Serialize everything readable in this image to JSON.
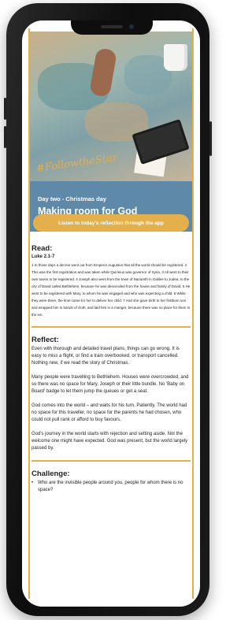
{
  "hero": {
    "logo_text": "#FollowtheStar"
  },
  "banner": {
    "subtitle": "Day two - Christmas day",
    "title": "Making room for God"
  },
  "listen_button": {
    "label": "Listen to today's reflection through the app"
  },
  "read": {
    "heading": "Read:",
    "reference": "Luke 2.1-7",
    "text": "1 In those days a decree went out from Emperor Augustus that all the world should be registered. 2 This was the first registration and was taken while Quirinius was governor of Syria. 3 All went to their own towns to be registered. 4 Joseph also went from the town of Nazareth in Galilee to Judea, to the city of David called Bethlehem, because he was descended from the house and family of David. 5 He went to be registered with Mary, to whom he was engaged and who was expecting a child. 6 While they were there, the time came for her to deliver her child. 7 And she gave birth to her firstborn son and wrapped him in bands of cloth, and laid him in a manger, because there was no place for them in the inn."
  },
  "reflect": {
    "heading": "Reflect:",
    "paragraphs": [
      "Even with thorough and detailed travel plans, things can go wrong. It is easy to miss a flight, or find a train overbooked, or transport cancelled. Nothing new, if we read the story of Christmas.",
      "Many people were travelling to Bethlehem. Houses were overcrowded, and so there was no space for Mary, Joseph or their little bundle. No 'Baby on Board' badge to let them jump the queues or get a seat.",
      "God comes into the world – and waits for his turn. Patiently. The world had no space for this traveller, no space for the parents he had chosen, who could not pull rank or afford to buy favours.",
      "God's journey in the world starts with rejection and setting aside. Not the welcome one might have expected. God was present, but the world largely passed by."
    ]
  },
  "challenge": {
    "heading": "Challenge:",
    "items": [
      "Who are the invisible people around you, people for whom there is no space?"
    ]
  },
  "colors": {
    "accent": "#e3b04b",
    "banner": "#5f89a8",
    "phone": "#111111"
  }
}
